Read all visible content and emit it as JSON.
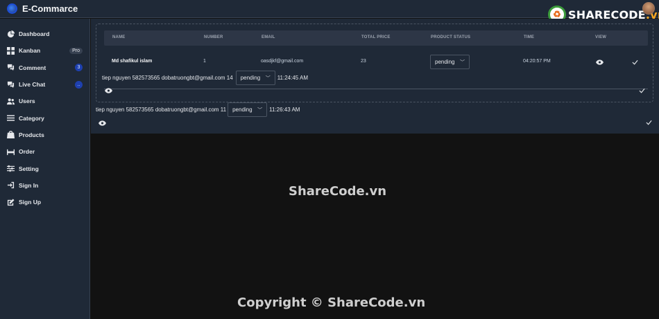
{
  "app": {
    "title": "E-Commarce"
  },
  "watermark": {
    "logo_text_main": "SHARECODE",
    "logo_text_suffix": ".vn",
    "center_text": "ShareCode.vn",
    "copyright_text": "Copyright © ShareCode.vn"
  },
  "sidebar": {
    "items": [
      {
        "label": "Dashboard",
        "icon": "dashboard-icon"
      },
      {
        "label": "Kanban",
        "icon": "kanban-icon",
        "badge": "Pro"
      },
      {
        "label": "Comment",
        "icon": "comment-icon",
        "badge": "3"
      },
      {
        "label": "Live Chat",
        "icon": "chat-icon",
        "badge": ".."
      },
      {
        "label": "Users",
        "icon": "users-icon"
      },
      {
        "label": "Category",
        "icon": "category-icon"
      },
      {
        "label": "Products",
        "icon": "products-icon"
      },
      {
        "label": "Order",
        "icon": "order-icon"
      },
      {
        "label": "Setting",
        "icon": "setting-icon"
      },
      {
        "label": "Sign In",
        "icon": "sign-in-icon"
      },
      {
        "label": "Sign Up",
        "icon": "sign-up-icon"
      }
    ]
  },
  "table": {
    "columns": [
      "NAME",
      "NUMBER",
      "EMAIL",
      "TOTAL PRICE",
      "PRODUCT STATUS",
      "TIME",
      "VIEW"
    ],
    "row": {
      "name": "Md shafikul islam",
      "number": "1",
      "email": "oasdjkf@gmail.com",
      "total_price": "23",
      "status": "pending",
      "time": "04:20:57 PM"
    }
  },
  "orders": [
    {
      "info": "tiep nguyen 582573565 dobatruongbt@gmail.com 14",
      "status": "pending",
      "time": "11:24:45 AM"
    },
    {
      "info": "tiep nguyen 582573565 dobatruongbt@gmail.com 11",
      "status": "pending",
      "time": "11:26:43 AM"
    }
  ],
  "colors": {
    "sidebar_bg": "#1f2937",
    "page_bg": "#121212",
    "accent": "#1e40af"
  }
}
